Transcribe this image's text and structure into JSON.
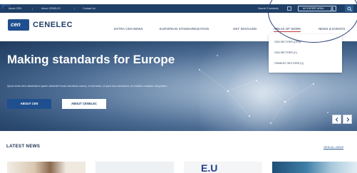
{
  "topbar": {
    "about_cen": "About CEN",
    "about_cenelec": "About CENELEC",
    "contact": "Contact Us",
    "search_standards": "Search Standards",
    "expert_area": "MY EXPERT AREA",
    "corner_glyph": "ıı"
  },
  "logo": {
    "mark": "cen",
    "name": "CENELEC"
  },
  "nav": {
    "items": [
      "EXTRA CEN NEWS",
      "EUROPEAN STANDARDIZATION",
      "GET INVOLVED",
      "AREAS OF WORK",
      "NEWS & EVENTS"
    ]
  },
  "dropdown": {
    "items": [
      "CEN SECTORS (CEN)",
      "CEN SECTORS (C)",
      "CENELEC SECTORS (C)"
    ]
  },
  "hero": {
    "title": "Making standards for Europe",
    "text": "Quod enim dem absentium quem delectet fructu mentiens venus, et forname, ut ipsa loco desidetur, et reddilis voluptas voluptates.",
    "primary_button": "ABOUT CEN",
    "secondary_button": "ABOUT CENELEC"
  },
  "news": {
    "title": "LATEST NEWS",
    "view_all": "VIEW ALL NEWS",
    "thumb_text": "E.U"
  },
  "colors": {
    "topbar": "#1f3f66",
    "brand": "#1f4f8f",
    "hero_dark": "#203a5e",
    "accent_underline": "#c43a3a"
  },
  "icons": [
    "search-icon",
    "user-icon",
    "chevron-left-icon",
    "chevron-right-icon"
  ]
}
